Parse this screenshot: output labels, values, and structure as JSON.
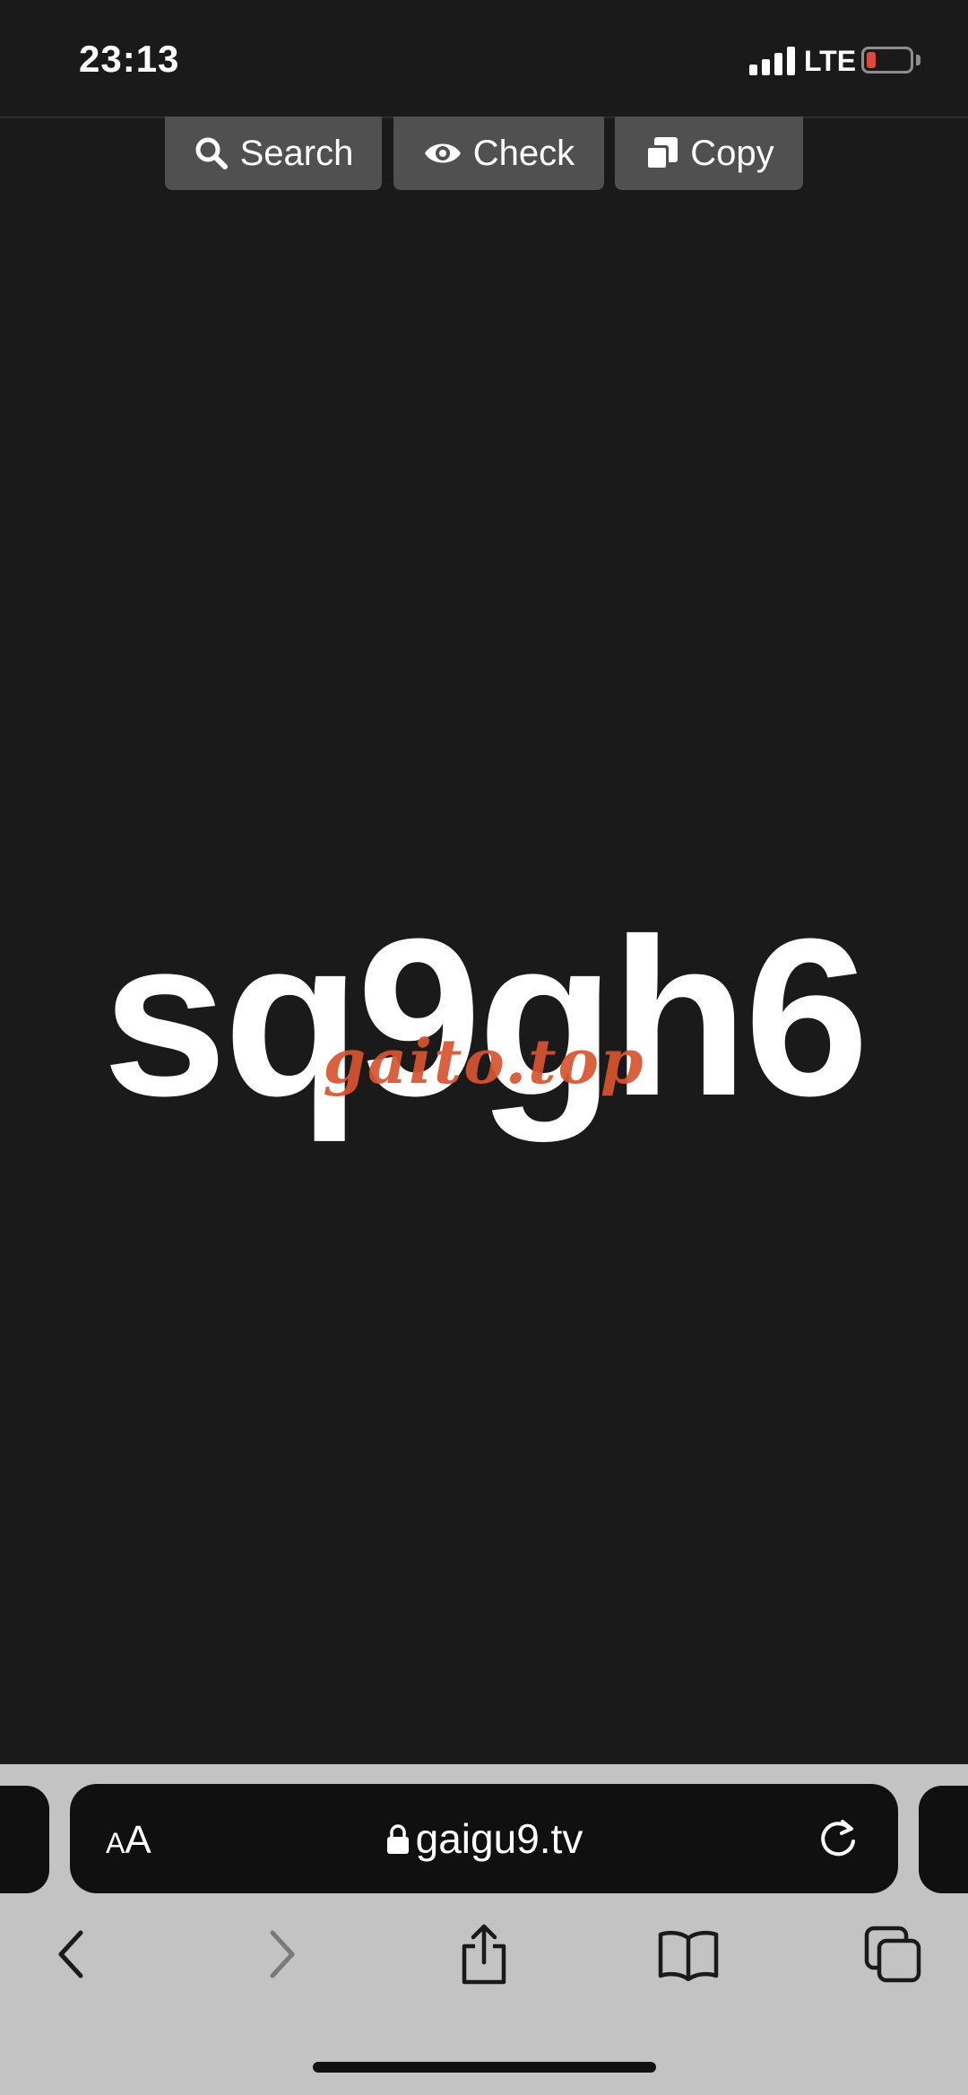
{
  "status_bar": {
    "time": "23:13",
    "network": "LTE",
    "battery_color": "#e4463b"
  },
  "toolbar": {
    "search_label": "Search",
    "check_label": "Check",
    "copy_label": "Copy"
  },
  "content": {
    "code": "sq9gh6",
    "watermark": "gaito.top"
  },
  "browser": {
    "aa_small": "A",
    "aa_big": "A",
    "url": "gaigu9.tv"
  }
}
